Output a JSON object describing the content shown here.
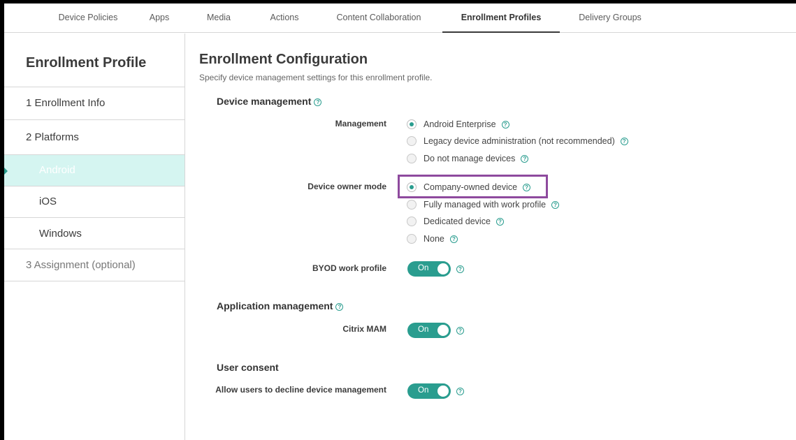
{
  "tabs": [
    "Device Policies",
    "Apps",
    "Media",
    "Actions",
    "Content Collaboration",
    "Enrollment Profiles",
    "Delivery Groups"
  ],
  "sidebar": {
    "title": "Enrollment Profile",
    "items": [
      {
        "label": "1  Enrollment Info"
      },
      {
        "label": "2  Platforms"
      },
      {
        "label": "Android"
      },
      {
        "label": "iOS"
      },
      {
        "label": "Windows"
      },
      {
        "label": "3  Assignment (optional)"
      }
    ]
  },
  "main": {
    "title": "Enrollment Configuration",
    "subtitle": "Specify device management settings for this enrollment profile.",
    "device_management": {
      "heading": "Device management",
      "management_label": "Management",
      "management_options": [
        "Android Enterprise",
        "Legacy device administration (not recommended)",
        "Do not manage devices"
      ],
      "management_selected": "Android Enterprise",
      "owner_mode_label": "Device owner mode",
      "owner_mode_options": [
        "Company-owned device",
        "Fully managed with work profile",
        "Dedicated device",
        "None"
      ],
      "owner_mode_selected": "Company-owned device",
      "byod_label": "BYOD work profile",
      "byod_value": "On"
    },
    "application_management": {
      "heading": "Application management",
      "mam_label": "Citrix MAM",
      "mam_value": "On"
    },
    "user_consent": {
      "heading": "User consent",
      "decline_label": "Allow users to decline device management",
      "decline_value": "On"
    }
  },
  "colors": {
    "accent": "#2a9d8f",
    "active_sidebar_bg": "#d5f5f1",
    "highlight_border": "#8e4a9e"
  }
}
